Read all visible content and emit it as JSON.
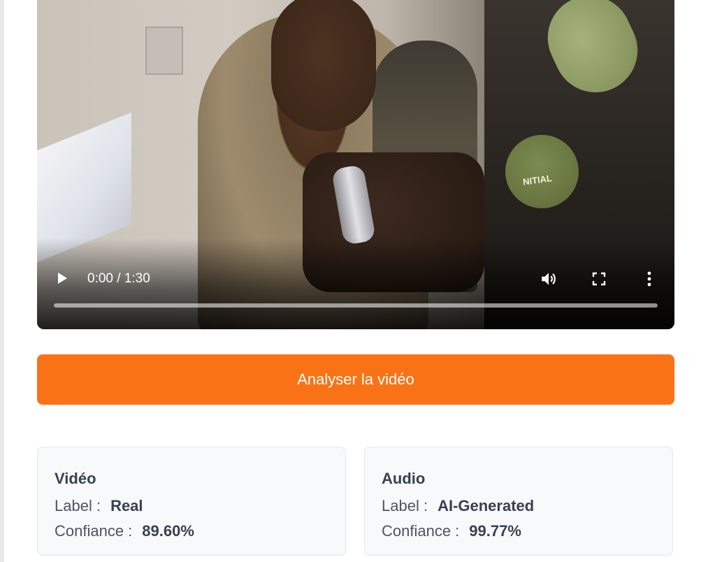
{
  "player": {
    "current_time": "0:00",
    "duration": "1:30",
    "time_text": "0:00 / 1:30",
    "progress": 0.0,
    "overlay_logo_text": "NITIAL",
    "icons": {
      "play": "play-icon",
      "volume": "volume-icon",
      "fullscreen": "fullscreen-icon",
      "more": "more-vertical-icon"
    }
  },
  "analyze_button": {
    "label": "Analyser la vidéo",
    "color": "#f97316"
  },
  "results": {
    "video": {
      "title": "Vidéo",
      "label_key": "Label :",
      "label_value": "Real",
      "confidence_key": "Confiance :",
      "confidence_value": "89.60%"
    },
    "audio": {
      "title": "Audio",
      "label_key": "Label :",
      "label_value": "AI-Generated",
      "confidence_key": "Confiance :",
      "confidence_value": "99.77%"
    }
  }
}
